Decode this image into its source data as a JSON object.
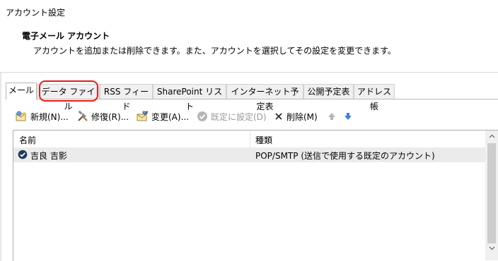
{
  "window": {
    "title": "アカウント設定"
  },
  "header": {
    "title": "電子メール アカウント",
    "description": "アカウントを追加または削除できます。また、アカウントを選択してその設定を変更できます。"
  },
  "tabs": [
    {
      "label": "メール"
    },
    {
      "label": "データ ファイル"
    },
    {
      "label": "RSS フィード"
    },
    {
      "label": "SharePoint リスト"
    },
    {
      "label": "インターネット予定表"
    },
    {
      "label": "公開予定表"
    },
    {
      "label": "アドレス帳"
    }
  ],
  "toolbar": {
    "new_label": "新規(N)...",
    "repair_label": "修復(R)...",
    "change_label": "変更(A)...",
    "default_label": "既定に設定(D)",
    "delete_label": "削除(M)"
  },
  "list": {
    "columns": [
      "名前",
      "種類"
    ],
    "rows": [
      {
        "name": "吉良 吉影",
        "type": "POP/SMTP (送信で使用する既定のアカウント)"
      }
    ]
  },
  "colors": {
    "highlight": "#e21d1d",
    "arrow_blue": "#3b7ee8",
    "check_dark": "#1f3b5c"
  }
}
